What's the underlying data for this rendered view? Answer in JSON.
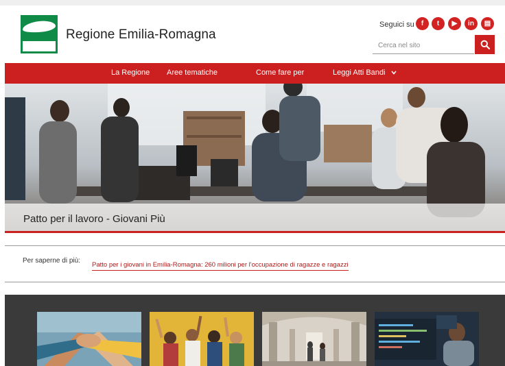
{
  "header": {
    "site_title": "Regione Emilia-Romagna",
    "follow_label": "Seguici su",
    "social": [
      {
        "icon": "facebook-icon",
        "glyph": "f"
      },
      {
        "icon": "twitter-icon",
        "glyph": "t"
      },
      {
        "icon": "youtube-icon",
        "glyph": "▶"
      },
      {
        "icon": "linkedin-icon",
        "glyph": "in"
      },
      {
        "icon": "newsletter-icon",
        "glyph": "▤"
      }
    ],
    "search_placeholder": "Cerca nel sito"
  },
  "nav": {
    "items": [
      "La Regione",
      "Aree tematiche",
      "Come fare per",
      "Leggi Atti Bandi"
    ]
  },
  "hero": {
    "caption": "Patto per il lavoro - Giovani Più"
  },
  "more": {
    "label": "Per saperne di più:",
    "link": "Patto per i giovani in Emilia-Romagna: 260 milioni per l'occupazione di ragazze e ragazzi"
  },
  "colors": {
    "brand_red": "#cc1f1f",
    "brand_green": "#0f8a47",
    "dark_section": "#3a3a3a"
  }
}
